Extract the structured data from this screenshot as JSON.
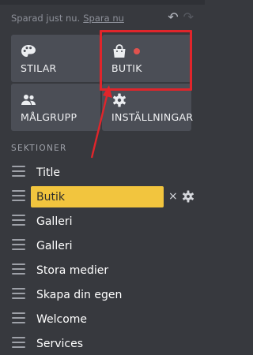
{
  "status": {
    "text": "Sparad just nu.",
    "link": "Spara nu"
  },
  "icons": {
    "undo": "undo-icon",
    "redo": "redo-icon"
  },
  "tiles": [
    {
      "label": "STILAR",
      "icon": "palette-icon"
    },
    {
      "label": "BUTIK",
      "icon": "shopping-bag-icon"
    },
    {
      "label": "MÅLGRUPP",
      "icon": "people-icon"
    },
    {
      "label": "INSTÄLLNINGAR",
      "icon": "gear-icon"
    }
  ],
  "sections_heading": "SEKTIONER",
  "sections": [
    {
      "label": "Title"
    },
    {
      "label": "Butik",
      "active": true
    },
    {
      "label": "Galleri"
    },
    {
      "label": "Galleri"
    },
    {
      "label": "Stora medier"
    },
    {
      "label": "Skapa din egen"
    },
    {
      "label": "Welcome"
    },
    {
      "label": "Services"
    }
  ],
  "row_actions": {
    "close": "×"
  },
  "colors": {
    "background": "#37393e",
    "tile": "#4b4e56",
    "active_section": "#f2c53e",
    "notification_dot": "#e0524e",
    "annotation": "#e0252b"
  }
}
